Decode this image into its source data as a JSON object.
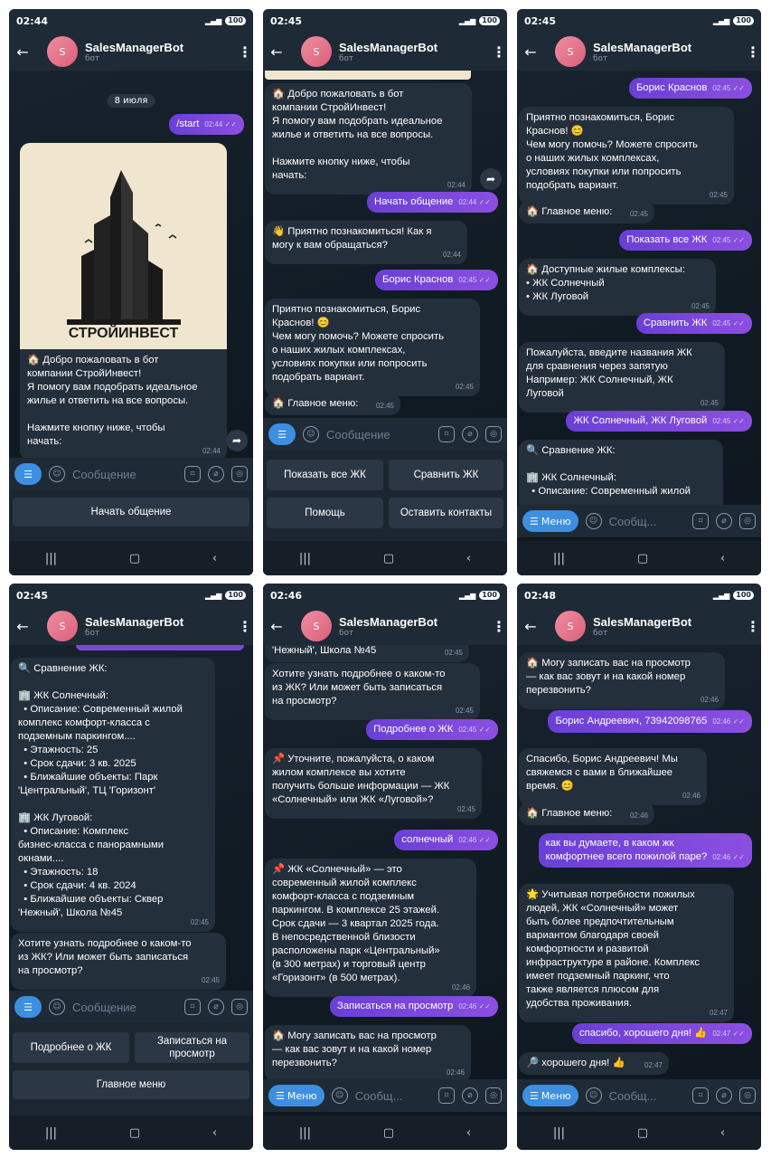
{
  "screens": [
    {
      "time": "02:44",
      "title": "SalesManagerBot",
      "subtitle": "бот",
      "avatar": "S",
      "battery": "100",
      "date": "8 июля",
      "msgs": [
        {
          "dir": "out",
          "text": "/start",
          "time": "02:44 ✓✓"
        },
        {
          "dir": "in",
          "text": "🏠 Добро пожаловать в бот\nкомпании СтройИнвест!\nЯ помогу вам подобрать идеальное\nжилье и ответить на все вопросы.\n\nНажмите кнопку ниже, чтобы\nначать:",
          "time": "02:44"
        }
      ],
      "image_brand": "СТРОЙИНВЕСТ",
      "input_placeholder": "Сообщение",
      "keyboard": [
        "Начать общение"
      ]
    },
    {
      "time": "02:45",
      "title": "SalesManagerBot",
      "subtitle": "бот",
      "avatar": "S",
      "battery": "100",
      "msgs": [
        {
          "dir": "in",
          "text": "🏠 Добро пожаловать в бот\nкомпании СтройИнвест!\nЯ помогу вам подобрать идеальное\nжилье и ответить на все вопросы.\n\nНажмите кнопку ниже, чтобы\nначать:",
          "time": "02:44"
        },
        {
          "dir": "out",
          "text": "Начать общение",
          "time": "02:44 ✓✓"
        },
        {
          "dir": "in",
          "text": "👋 Приятно познакомиться! Как я\nмогу к вам обращаться?",
          "time": "02:44"
        },
        {
          "dir": "out",
          "text": "Борис Краснов",
          "time": "02:45 ✓✓"
        },
        {
          "dir": "in",
          "text": "Приятно познакомиться, Борис\nКраснов! 😊\nЧем могу помочь? Можете спросить\nо наших жилых комплексах,\nусловиях покупки или попросить\nподобрать вариант.",
          "time": "02:45"
        },
        {
          "dir": "in",
          "text": "🏠 Главное меню:",
          "time": "02:45"
        }
      ],
      "input_placeholder": "Сообщение",
      "keyboard": [
        "Показать все ЖК",
        "Сравнить ЖК",
        "Помощь",
        "Оставить контакты"
      ]
    },
    {
      "time": "02:45",
      "title": "SalesManagerBot",
      "subtitle": "бот",
      "avatar": "S",
      "battery": "100",
      "msgs": [
        {
          "dir": "out",
          "text": "Борис Краснов",
          "time": "02:45 ✓✓"
        },
        {
          "dir": "in",
          "text": "Приятно познакомиться, Борис\nКраснов! 😊\nЧем могу помочь? Можете спросить\nо наших жилых комплексах,\nусловиях покупки или попросить\nподобрать вариант.",
          "time": "02:45"
        },
        {
          "dir": "in",
          "text": "🏠 Главное меню:",
          "time": "02:45"
        },
        {
          "dir": "out",
          "text": "Показать все ЖК",
          "time": "02:45 ✓✓"
        },
        {
          "dir": "in",
          "text": "🏠 Доступные жилые комплексы:\n• ЖК Солнечный\n• ЖК Луговой",
          "time": "02:45"
        },
        {
          "dir": "out",
          "text": "Сравнить ЖК",
          "time": "02:45 ✓✓"
        },
        {
          "dir": "in",
          "text": "Пожалуйста, введите названия ЖК\nдля сравнения через запятую\nНапример: ЖК Солнечный, ЖК\nЛуговой",
          "time": "02:45"
        },
        {
          "dir": "out",
          "text": "ЖК Солнечный, ЖК Луговой",
          "time": "02:45 ✓✓"
        },
        {
          "dir": "in",
          "text": "🔍 Сравнение ЖК:\n\n🏢 ЖК Солнечный:\n  • Описание: Современный жилой",
          "time": ""
        }
      ],
      "menu_label": "Меню",
      "input_placeholder": "Сообщ..."
    },
    {
      "time": "02:45",
      "title": "SalesManagerBot",
      "subtitle": "бот",
      "avatar": "S",
      "battery": "100",
      "msgs": [
        {
          "dir": "in",
          "text": "🔍 Сравнение ЖК:\n\n🏢 ЖК Солнечный:\n  • Описание: Современный жилой\nкомплекс комфорт-класса с\nподземным паркингом....\n  • Этажность: 25\n  • Срок сдачи: 3 кв. 2025\n  • Ближайшие объекты: Парк\n'Центральный', ТЦ 'Горизонт'\n\n🏢 ЖК Луговой:\n  • Описание: Комплекс\nбизнес-класса с панорамными\nокнами....\n  • Этажность: 18\n  • Срок сдачи: 4 кв. 2024\n  • Ближайшие объекты: Сквер\n'Нежный', Школа №45",
          "time": "02:45"
        },
        {
          "dir": "in",
          "text": "Хотите узнать подробнее о каком-то\nиз ЖК? Или может быть записаться\nна просмотр?",
          "time": "02:45"
        }
      ],
      "input_placeholder": "Сообщение",
      "keyboard": [
        "Подробнее о ЖК",
        "Записаться на\nпросмотр",
        "Главное меню"
      ]
    },
    {
      "time": "02:46",
      "title": "SalesManagerBot",
      "subtitle": "бот",
      "avatar": "S",
      "battery": "100",
      "msgs": [
        {
          "dir": "in",
          "text": "'Нежный', Школа №45",
          "time": "02:45"
        },
        {
          "dir": "in",
          "text": "Хотите узнать подробнее о каком-то\nиз ЖК? Или может быть записаться\nна просмотр?",
          "time": "02:45"
        },
        {
          "dir": "out",
          "text": "Подробнее о ЖК",
          "time": "02:45 ✓✓"
        },
        {
          "dir": "in",
          "text": "📌 Уточните, пожалуйста, о каком\nжилом комплексе вы хотите\nполучить больше информации — ЖК\n«Солнечный» или ЖК «Луговой»?",
          "time": "02:45"
        },
        {
          "dir": "out",
          "text": "солнечный",
          "time": "02:46 ✓✓"
        },
        {
          "dir": "in",
          "text": "📌 ЖК «Солнечный» — это\nсовременный жилой комплекс\nкомфорт-класса с подземным\nпаркингом. В комплексе 25 этажей.\nСрок сдачи — 3 квартал 2025 года.\nВ непосредственной близости\nрасположены парк «Центральный»\n(в 300 метрах) и торговый центр\n«Горизонт» (в 500 метрах).",
          "time": "02:46"
        },
        {
          "dir": "out",
          "text": "Записаться на просмотр",
          "time": "02:46 ✓✓"
        },
        {
          "dir": "in",
          "text": "🏠 Могу записать вас на просмотр\n— как вас зовут и на какой номер\nперезвонить?",
          "time": "02:46"
        }
      ],
      "menu_label": "Меню",
      "input_placeholder": "Сообщ..."
    },
    {
      "time": "02:48",
      "title": "SalesManagerBot",
      "subtitle": "бот",
      "avatar": "S",
      "battery": "100",
      "msgs": [
        {
          "dir": "in",
          "text": "🏠 Могу записать вас на просмотр\n— как вас зовут и на какой номер\nперезвонить?",
          "time": "02:46"
        },
        {
          "dir": "out",
          "text": "Борис Андреевич, 73942098765",
          "time": "02:46 ✓✓"
        },
        {
          "dir": "in",
          "text": "Спасибо, Борис Андреевич! Мы\nсвяжемся с вами в ближайшее\nвремя. 😊",
          "time": "02:46"
        },
        {
          "dir": "in",
          "text": "🏠 Главное меню:",
          "time": "02:46"
        },
        {
          "dir": "out",
          "text": "как вы думаете, в каком жк\nкомфортнее всего пожилой паре?",
          "time": "02:46 ✓✓"
        },
        {
          "dir": "in",
          "text": "🌟 Учитывая потребности пожилых\nлюдей, ЖК «Солнечный» может\nбыть более предпочтительным\nвариантом благодаря своей\nкомфортности и развитой\nинфраструктуре в районе. Комплекс\nимеет подземный паркинг, что\nтакже является плюсом для\nудобства проживания.",
          "time": "02:47"
        },
        {
          "dir": "out",
          "text": "спасибо, хорошего дня! 👍",
          "time": "02:47 ✓✓"
        },
        {
          "dir": "in",
          "text": "🔎 хорошего дня! 👍",
          "time": "02:47"
        }
      ],
      "menu_label": "Меню",
      "input_placeholder": "Сообщ..."
    }
  ]
}
